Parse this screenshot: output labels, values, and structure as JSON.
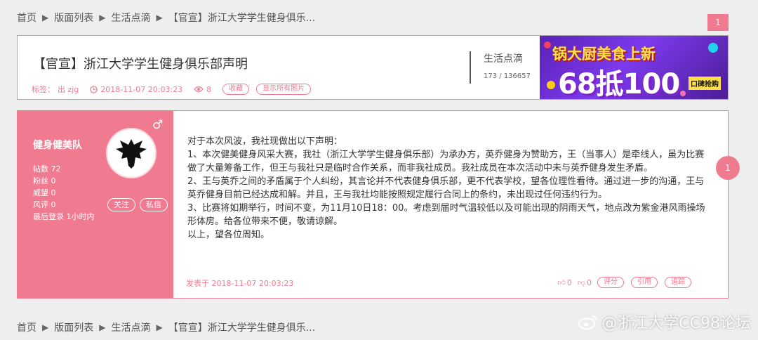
{
  "breadcrumb": {
    "items": [
      "首页",
      "版面列表",
      "生活点滴",
      "【官宣】浙江大学学生健身俱乐..."
    ]
  },
  "pagination": {
    "current": "1"
  },
  "topic": {
    "title": "【官宣】浙江大学学生健身俱乐部声明",
    "tags_label": "标签：",
    "author": "出 zjg",
    "datetime": "2018-11-07 20:03:23",
    "views": "8",
    "favorite_label": "收藏",
    "show_images_label": "显示所有图片",
    "board_name": "生活点滴",
    "board_stats": "173 / 136657"
  },
  "ad": {
    "line1": "锅大厨美食上新",
    "line2": "68抵100",
    "tag": "口碑抢购"
  },
  "post": {
    "username": "健身健美队",
    "stats": [
      "帖数 72",
      "粉丝 0",
      "威望 0",
      "风评 0",
      "最后登录 1小时内"
    ],
    "follow_label": "关注",
    "message_label": "私信",
    "content": [
      "对于本次风波，我社现做出以下声明：",
      "1、本次健美健身风采大赛，我社（浙江大学学生健身俱乐部）为承办方，英乔健身为赞助方，王（当事人）是牵线人，虽为比赛做了大量筹备工作，但王与我社只是临时合作关系，而非我社成员。我社成员在本次活动中未与英乔健身发生矛盾。",
      "2、王与英乔之间的矛盾属于个人纠纷，其言论并不代表健身俱乐部，更不代表学校，望各位理性看待。通过进一步的沟通，王与英乔健身目前已经达成和解。并且，王与我社均能按照规定履行合同上的条约，未出现过任何违约行为。",
      "3、比赛将如期举行，时间不变，为11月10日18：00。考虑到届时气温较低以及可能出现的阴雨天气，地点改为紫金港风雨操场形体房。给各位带来不便，敬请谅解。",
      "以上，望各位周知。"
    ],
    "time": "发表于 2018-11-07 20:03:23",
    "likes": "0",
    "dislikes": "0",
    "rate_label": "评分",
    "quote_label": "引用",
    "trace_label": "追踪",
    "floor": "1"
  },
  "watermark": {
    "text": "@浙江大学CC98论坛"
  },
  "colors": {
    "accent": "#f07a8f",
    "background": "#eeeeee"
  }
}
